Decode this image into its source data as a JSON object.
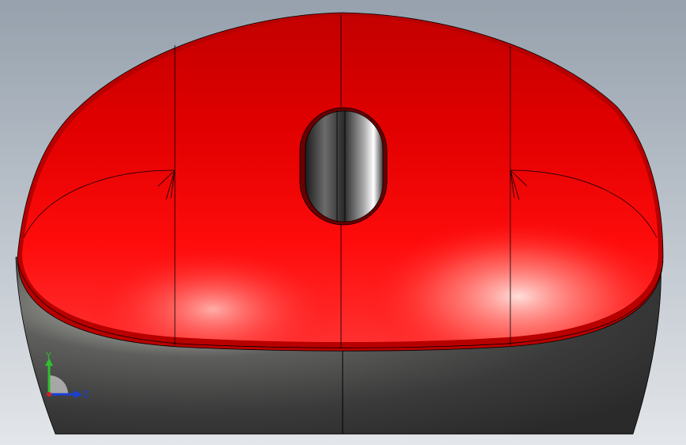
{
  "viewport": {
    "background_top": "#96a1ad",
    "background_bottom": "#e3e6ea"
  },
  "model": {
    "top_shell_color": "#ff0000",
    "base_color": "#4b4b4b",
    "edge_color": "#000000"
  },
  "triad": {
    "y_label": "Y",
    "z_label": "Z",
    "y_color": "#2fbf2f",
    "z_color": "#1a3fd6",
    "x_color": "#d32020"
  }
}
